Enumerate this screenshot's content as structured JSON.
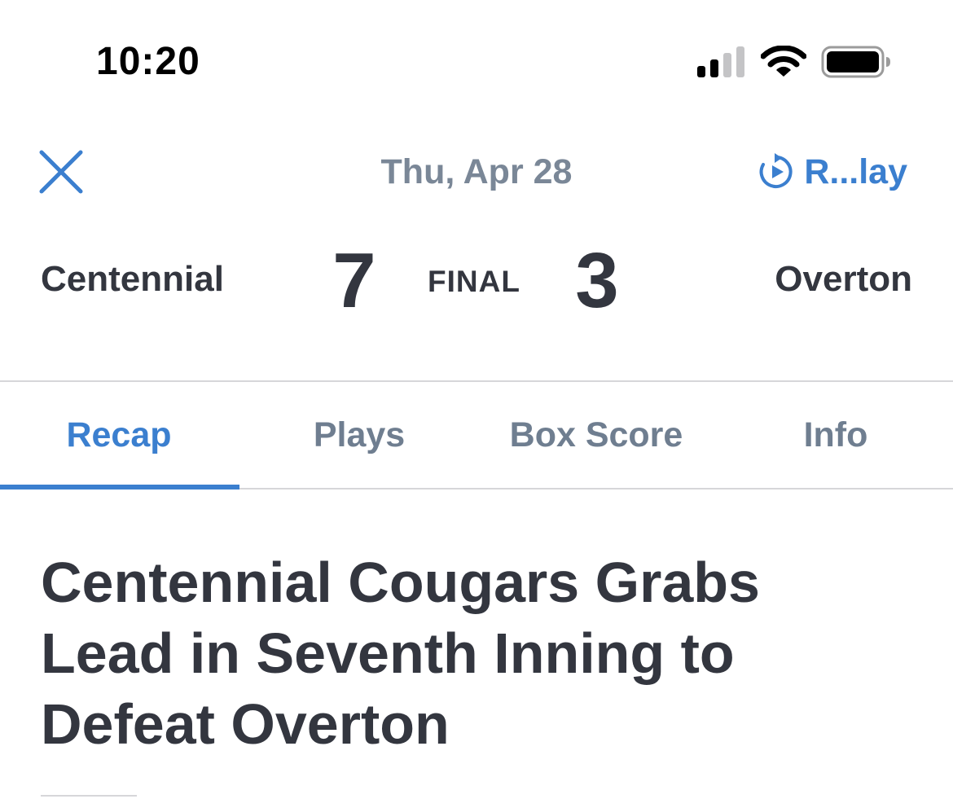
{
  "status_bar": {
    "time": "10:20",
    "icons": [
      "cellular-signal-icon",
      "wifi-icon",
      "battery-icon"
    ]
  },
  "header": {
    "close_icon": "close-icon",
    "date": "Thu, Apr 28",
    "replay_icon": "replay-icon",
    "replay_label": "R...lay"
  },
  "scoreboard": {
    "home_team": "Centennial",
    "home_score": "7",
    "status": "FINAL",
    "away_score": "3",
    "away_team": "Overton"
  },
  "tabs": [
    {
      "label": "Recap",
      "active": true
    },
    {
      "label": "Plays",
      "active": false
    },
    {
      "label": "Box Score",
      "active": false
    },
    {
      "label": "Info",
      "active": false
    }
  ],
  "article": {
    "headline": "Centennial Cougars Grabs Lead in Seventh Inning to Defeat Overton"
  },
  "colors": {
    "accent": "#3b7fcf",
    "text_dark": "#33363f",
    "text_muted": "#7a8797",
    "divider": "#d6d6d9"
  }
}
